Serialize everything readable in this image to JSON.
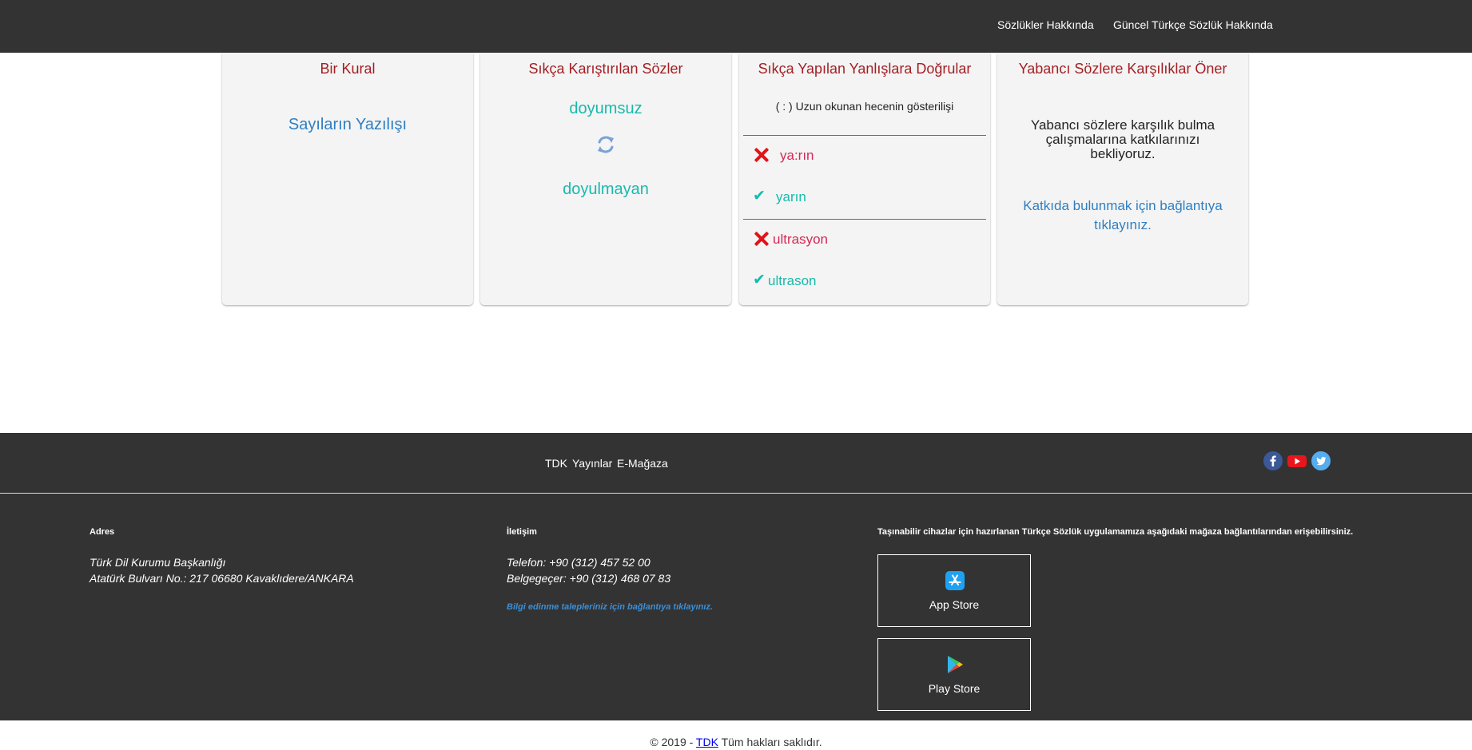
{
  "header": {
    "nav": [
      "Sözlükler Hakkında",
      "Güncel Türkçe Sözlük Hakkında"
    ]
  },
  "cards": {
    "rule": {
      "title": "Bir Kural",
      "link": "Sayıların Yazılışı"
    },
    "confused": {
      "title": "Sıkça Karıştırılan Sözler",
      "word1": "doyumsuz",
      "word2": "doyulmayan",
      "icon": "refresh-icon"
    },
    "mistakes": {
      "title": "Sıkça Yapılan Yanlışlara Doğrular",
      "note": "( : ) Uzun okunan hecenin gösterilişi",
      "items": [
        {
          "wrong": "ya:rın",
          "right": "yarın"
        },
        {
          "wrong": "ultrasyon",
          "right": "ultrason"
        }
      ]
    },
    "foreign": {
      "title": "Yabancı Sözlere Karşılıklar Öner",
      "text": "Yabancı sözlere karşılık bulma çalışmalarına katkılarınızı bekliyoruz.",
      "link": "Katkıda bulunmak için bağlantıya tıklayınız."
    }
  },
  "footer": {
    "links": [
      "TDK",
      "Yayınlar",
      "E-Mağaza"
    ],
    "social": [
      "facebook-icon",
      "youtube-icon",
      "twitter-icon"
    ],
    "address": {
      "heading": "Adres",
      "line1": "Türk Dil Kurumu Başkanlığı",
      "line2": "Atatürk Bulvarı No.: 217 06680 Kavaklıdere/ANKARA"
    },
    "contact": {
      "heading": "İletişim",
      "phone": "Telefon: +90 (312) 457 52 00",
      "fax": "Belgegeçer: +90 (312) 468 07 83",
      "link": "Bilgi edinme talepleriniz için bağlantıya tıklayınız."
    },
    "apps": {
      "heading": "Taşınabilir cihazlar için hazırlanan Türkçe Sözlük uygulamamıza aşağıdaki mağaza bağlantılarından erişebilirsiniz.",
      "app_store": "App Store",
      "play_store": "Play Store"
    },
    "copyright": {
      "prefix": "© 2019 -",
      "link": "TDK",
      "suffix": "Tüm hakları saklıdır."
    }
  },
  "colors": {
    "dark_bg": "#333333",
    "card_bg": "#f4f4f4",
    "title_red": "#a31f24",
    "link_blue": "#2f7fc1",
    "teal": "#19b9ad",
    "wrong_pink": "#d42956"
  }
}
